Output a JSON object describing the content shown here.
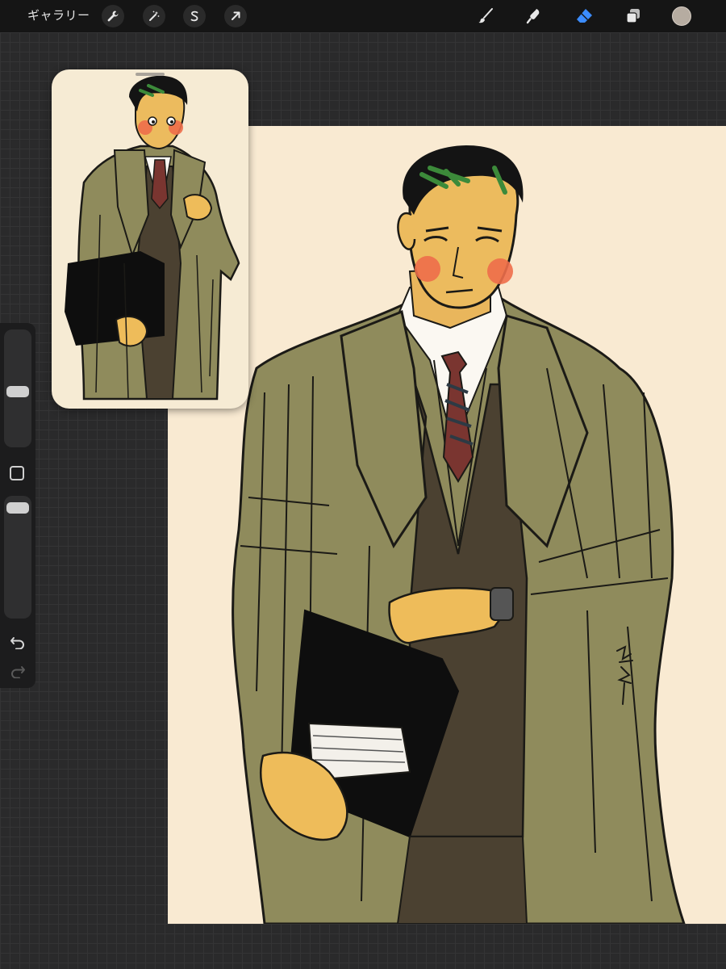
{
  "topbar": {
    "gallery_label": "ギャラリー",
    "left_tools": [
      "wrench-icon",
      "magic-wand-icon",
      "selection-icon",
      "transform-arrow-icon"
    ],
    "right_tools": [
      "brush-icon",
      "smudge-icon",
      "eraser-icon",
      "layers-icon"
    ],
    "active_tool": "eraser-icon",
    "active_color": "#b6aca1",
    "accent": "#3b8cff"
  },
  "sidebar": {
    "size_level": 0.2,
    "opacity_level": 0.05,
    "tools": [
      "brush-size-slider",
      "modify-button",
      "opacity-slider",
      "undo-icon",
      "redo-icon"
    ]
  },
  "reference_window": {
    "visible": true,
    "content": "reference-artwork"
  },
  "canvas": {
    "background": "#f9ead2",
    "artwork": "illustration-man-in-trench-coat"
  }
}
